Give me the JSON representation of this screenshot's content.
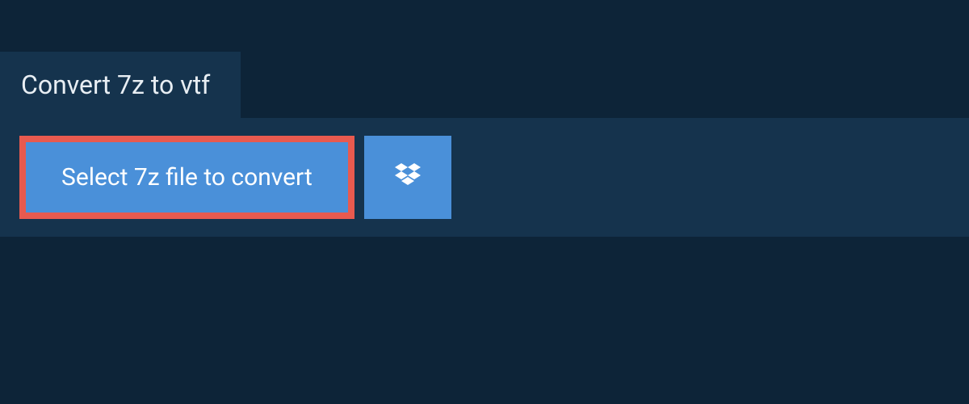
{
  "tab": {
    "label": "Convert 7z to vtf"
  },
  "actions": {
    "select_label": "Select 7z file to convert"
  },
  "colors": {
    "background": "#0d2438",
    "panel": "#15334d",
    "button": "#4a90d9",
    "highlight_border": "#e85a4f",
    "text_light": "#ffffff"
  }
}
